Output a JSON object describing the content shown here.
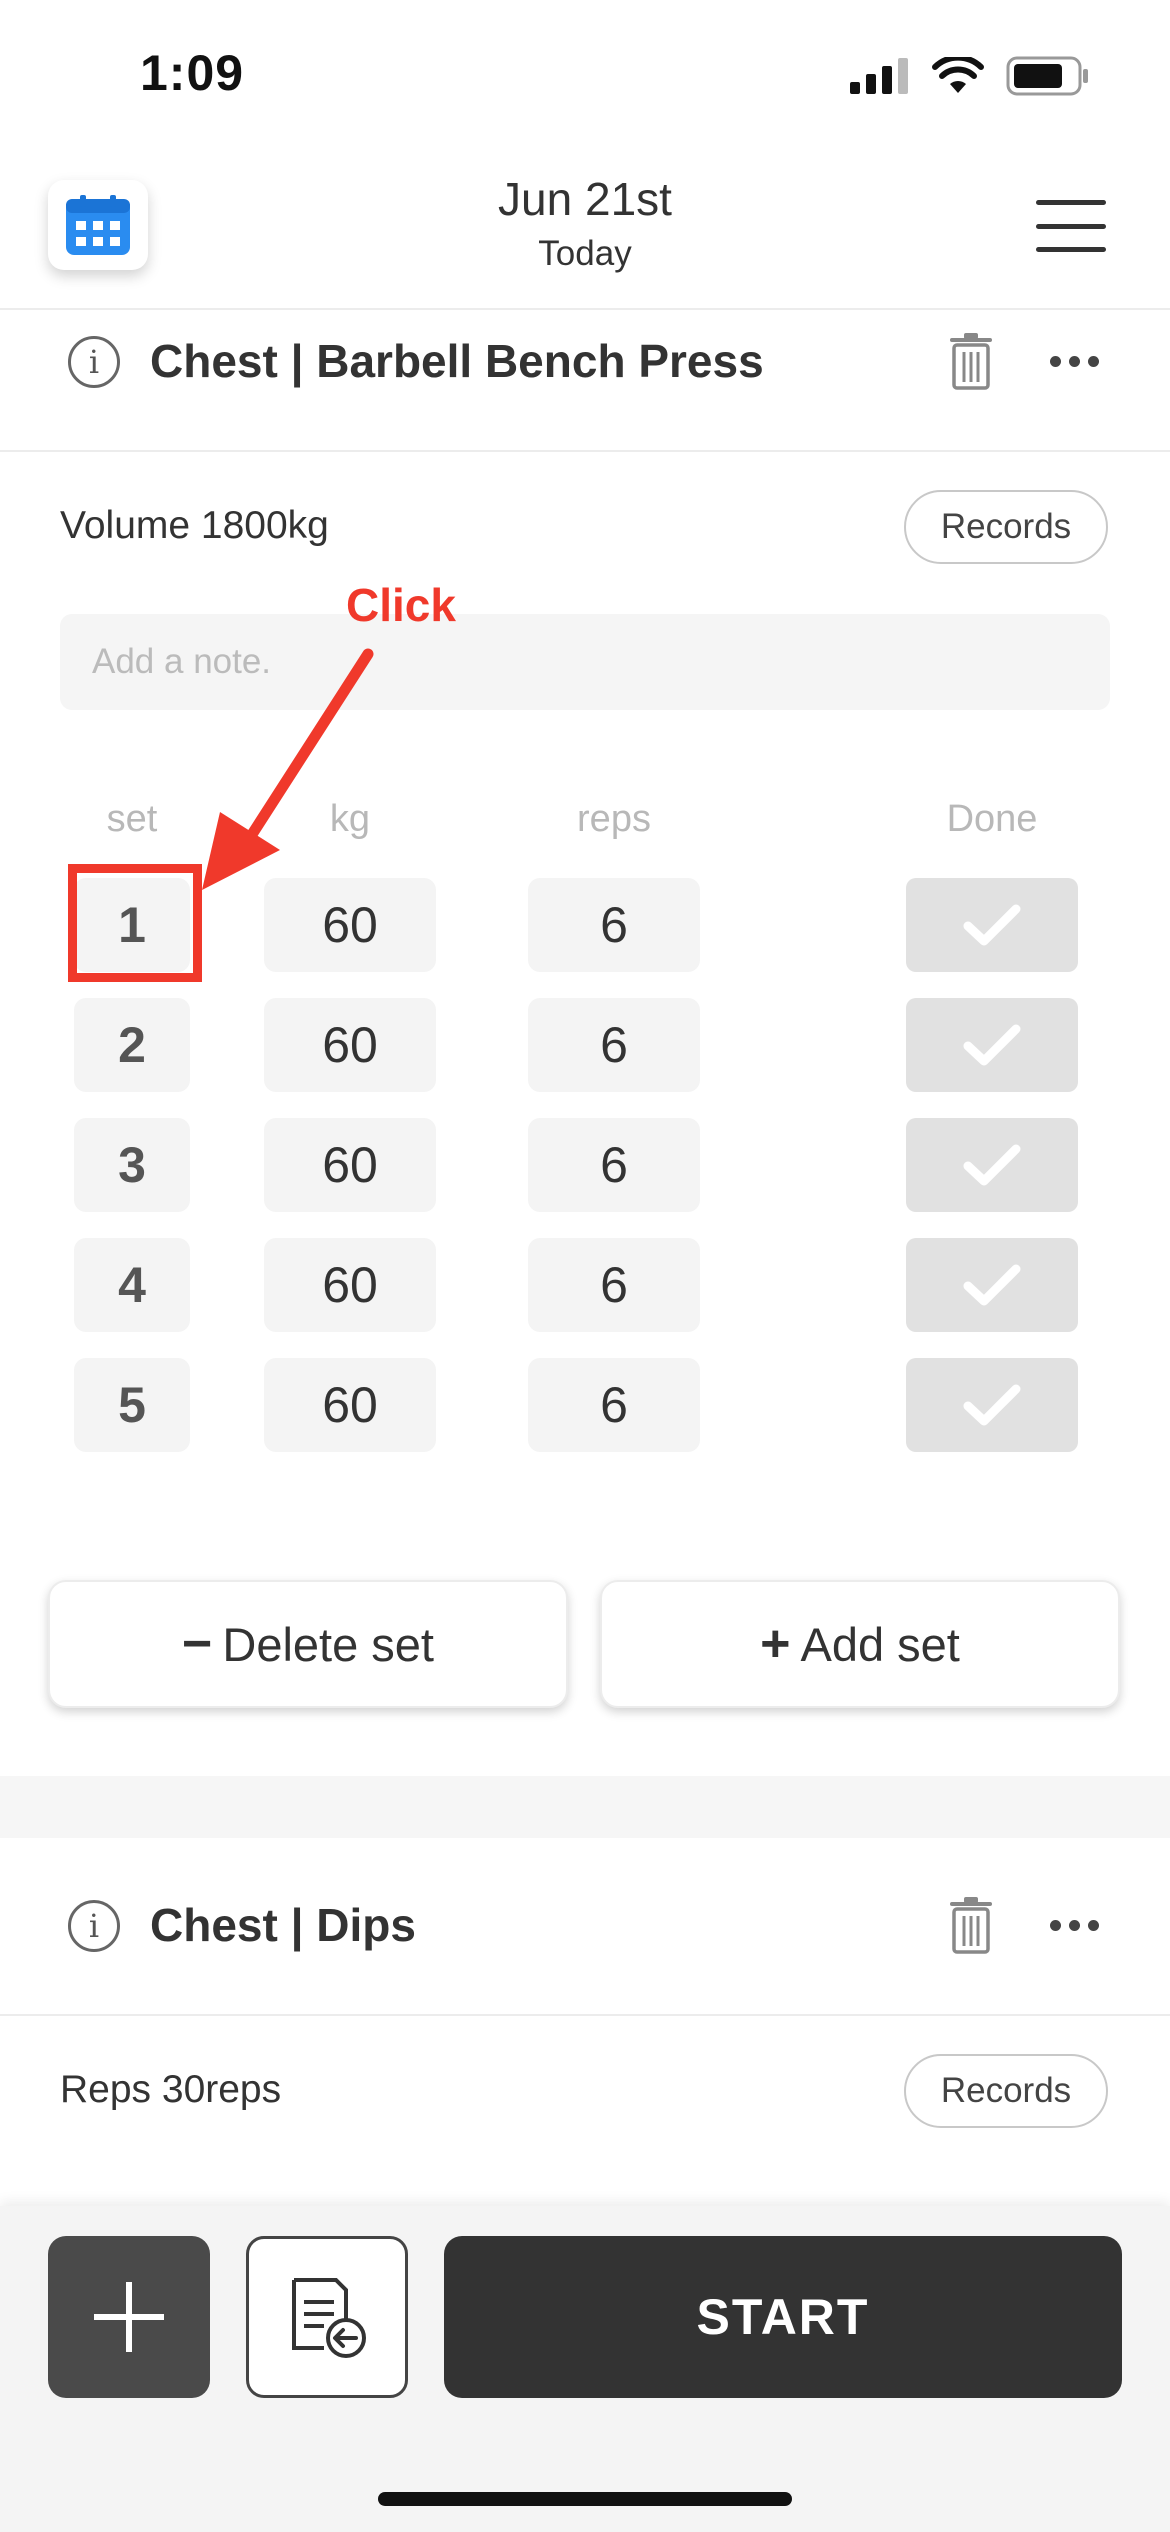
{
  "status_bar": {
    "time": "1:09"
  },
  "header": {
    "title": "Jun 21st",
    "subtitle": "Today"
  },
  "exercise1": {
    "title": "Chest | Barbell Bench Press",
    "info_glyph": "i",
    "summary": "Volume 1800kg",
    "records_label": "Records",
    "note_placeholder": "Add a note.",
    "columns": {
      "set": "set",
      "kg": "kg",
      "reps": "reps",
      "done": "Done"
    },
    "sets": [
      {
        "set": "1",
        "kg": "60",
        "reps": "6"
      },
      {
        "set": "2",
        "kg": "60",
        "reps": "6"
      },
      {
        "set": "3",
        "kg": "60",
        "reps": "6"
      },
      {
        "set": "4",
        "kg": "60",
        "reps": "6"
      },
      {
        "set": "5",
        "kg": "60",
        "reps": "6"
      }
    ],
    "delete_set": {
      "icon": "−",
      "label": "Delete set"
    },
    "add_set": {
      "icon": "+",
      "label": "Add set"
    }
  },
  "exercise2": {
    "title": "Chest | Dips",
    "info_glyph": "i",
    "summary": "Reps 30reps",
    "records_label": "Records"
  },
  "bottom_bar": {
    "start_label": "START"
  },
  "annotation": {
    "label": "Click",
    "color": "#f0392b"
  }
}
